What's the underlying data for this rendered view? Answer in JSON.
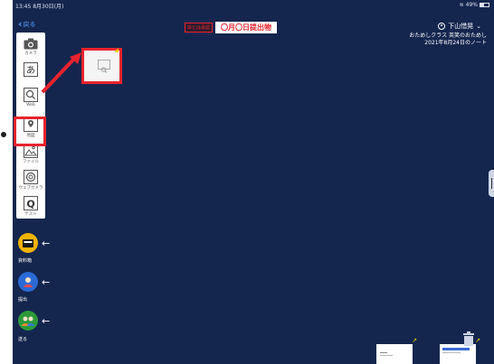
{
  "status_bar": {
    "time_date": "13:45 8月30日(月)",
    "battery": "49%"
  },
  "back_label": "戻る",
  "header": {
    "badge": "あとは承認",
    "title": "〇月〇日提出物",
    "user": "下山惜晃",
    "class_line": "おためしクラス 英笑のおためし",
    "note_line": "2021年8月24日のノート"
  },
  "toolbar": {
    "tools": [
      {
        "label": "カメラ",
        "icon": "camera-icon"
      },
      {
        "label": "",
        "icon": "text-icon"
      },
      {
        "label": "Web",
        "icon": "web-search-icon"
      },
      {
        "label": "地図",
        "icon": "map-icon"
      },
      {
        "label": "ファイル",
        "icon": "file-icon"
      },
      {
        "label": "ウェブカメラ",
        "icon": "webcam-icon"
      },
      {
        "label": "テスト",
        "icon": "quiz-icon"
      }
    ]
  },
  "actions": [
    {
      "label": "資料箱",
      "icon": "materials-box-icon",
      "color": "#f0b400"
    },
    {
      "label": "提出",
      "icon": "submit-icon",
      "color": "#2a6ad6"
    },
    {
      "label": "送る",
      "icon": "send-icon",
      "color": "#2a9a3a"
    }
  ],
  "colors": {
    "background": "#14264e",
    "highlight": "#e8232d",
    "accent": "#5aa0ff"
  }
}
